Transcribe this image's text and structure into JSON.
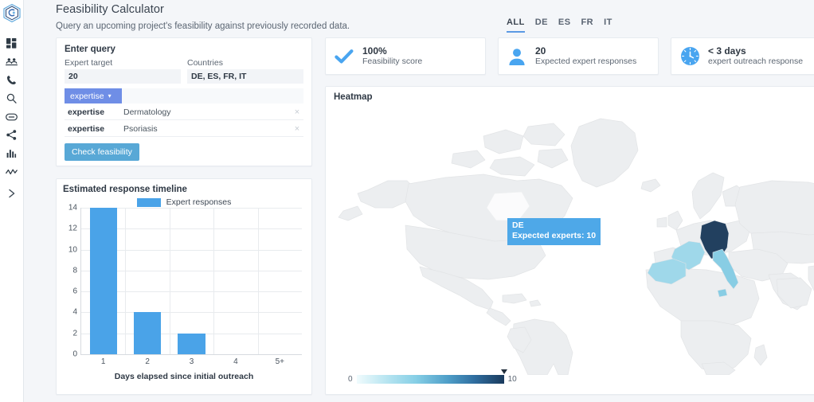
{
  "sidebar": {
    "logo_name": "company-hex-logo",
    "items": [
      {
        "name": "dashboard-icon",
        "label": "Dashboard"
      },
      {
        "name": "people-icon",
        "label": "Experts"
      },
      {
        "name": "phone-icon",
        "label": "Calls"
      },
      {
        "name": "search-icon",
        "label": "Search"
      },
      {
        "name": "link-icon",
        "label": "Links"
      },
      {
        "name": "share-icon",
        "label": "Share"
      },
      {
        "name": "bar-chart-icon",
        "label": "Reports"
      },
      {
        "name": "line-chart-icon",
        "label": "Trends"
      }
    ],
    "expand_label": "Expand sidebar"
  },
  "header": {
    "title": "Feasibility Calculator",
    "subtitle": "Query an upcoming project's feasibility against previously recorded data."
  },
  "tabs": {
    "items": [
      {
        "label": "ALL",
        "active": true
      },
      {
        "label": "DE",
        "active": false
      },
      {
        "label": "ES",
        "active": false
      },
      {
        "label": "FR",
        "active": false
      },
      {
        "label": "IT",
        "active": false
      }
    ]
  },
  "kpis": [
    {
      "icon": "check-icon",
      "value": "100%",
      "label": "Feasibility score"
    },
    {
      "icon": "person-icon",
      "value": "20",
      "label": "Expected expert responses"
    },
    {
      "icon": "clock-icon",
      "value": "< 3 days",
      "label": "expert outreach response"
    }
  ],
  "query": {
    "title": "Enter query",
    "expert_target_label": "Expert target",
    "expert_target_value": "20",
    "expert_target_placeholder": "Expert target",
    "countries_label": "Countries",
    "countries_value": "DE, ES, FR, IT",
    "countries_placeholder": "Countries",
    "filter_chip_label": "expertise",
    "filter_chip_caret": "▾",
    "filter_input_value": "",
    "filter_input_placeholder": "",
    "criteria": [
      {
        "key": "expertise",
        "value": "Dermatology",
        "remove": "×"
      },
      {
        "key": "expertise",
        "value": "Psoriasis",
        "remove": "×"
      }
    ],
    "submit_label": "Check feasibility"
  },
  "timeline_panel": {
    "title": "Estimated response timeline"
  },
  "chart_data": {
    "type": "bar",
    "title": "Estimated response timeline",
    "categories": [
      "1",
      "2",
      "3",
      "4",
      "5+"
    ],
    "values": [
      14,
      4,
      2,
      0,
      0
    ],
    "series": [
      {
        "name": "Expert responses",
        "values": [
          14,
          4,
          2,
          0,
          0
        ],
        "color": "#4aa3e8"
      }
    ],
    "xlabel": "Days elapsed since initial outreach",
    "ylabel": "",
    "ylim": [
      0,
      14
    ],
    "yticks": [
      0,
      2,
      4,
      6,
      8,
      10,
      12,
      14
    ],
    "grid": true,
    "legend": [
      "Expert responses"
    ],
    "legend_position": "top-center"
  },
  "map": {
    "title": "Heatmap",
    "tooltip": {
      "country": "DE",
      "detail": "Expected experts: 10"
    },
    "legend": {
      "min": "0",
      "max": "10",
      "marker_value": "10"
    },
    "highlights": [
      {
        "code": "DE",
        "value": 10,
        "color": "#22405f"
      },
      {
        "code": "FR",
        "value": 3,
        "color": "#9fd8ea"
      },
      {
        "code": "ES",
        "value": 3,
        "color": "#9fd8ea"
      },
      {
        "code": "IT",
        "value": 4,
        "color": "#88cde4"
      }
    ],
    "base_land_color": "#eceef0"
  }
}
